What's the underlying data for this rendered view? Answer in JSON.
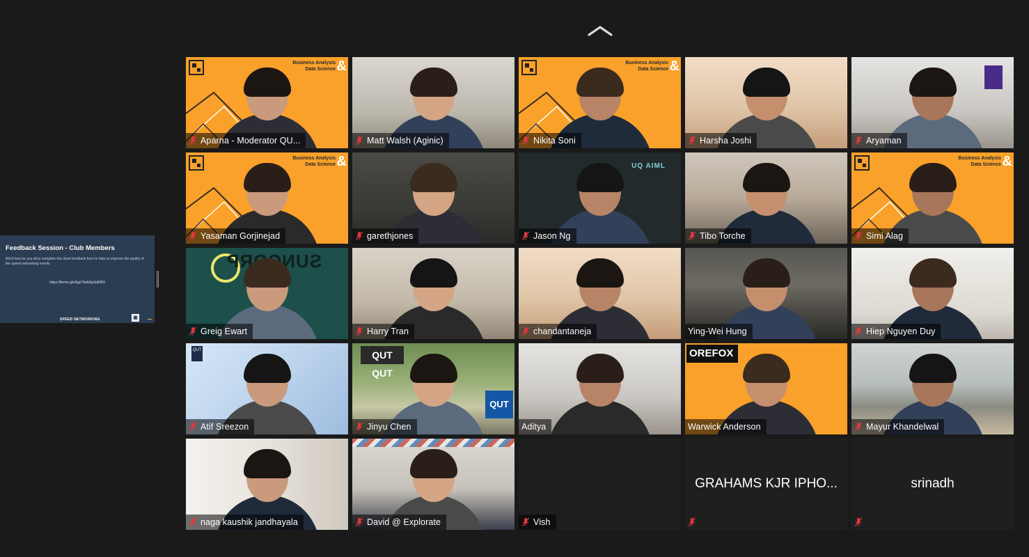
{
  "meeting": {
    "view": "gallery",
    "chevron_icon": "chevron-up-icon"
  },
  "share": {
    "title": "Feedback Session - Club Members",
    "body": "We'd love for you all to complete this short feedback form to help us improve the quality of the speed networking events",
    "link": "https://forms.gle/5gsT6ebGp3x8369",
    "brand": "SPEED NETWORKING"
  },
  "background_text": {
    "ba_ds": "Business Analysis\nData Science",
    "amp": "&",
    "suncorp": "SUNCORP",
    "uqaiml": "UQ AIML",
    "orefox": "OREFOX",
    "qut": "QUT",
    "qut_qut": "QUT QUT"
  },
  "participants": [
    {
      "name": "Aparna - Moderator QU...",
      "muted": true,
      "bg": "orange"
    },
    {
      "name": "Matt Walsh (Aginic)",
      "muted": true,
      "bg": "wall"
    },
    {
      "name": "Nikita Soni",
      "muted": true,
      "bg": "orange"
    },
    {
      "name": "Harsha Joshi",
      "muted": true,
      "bg": "warm"
    },
    {
      "name": "Aryaman",
      "muted": true,
      "bg": "room"
    },
    {
      "name": "Yasaman Gorjinejad",
      "muted": true,
      "bg": "orange"
    },
    {
      "name": "garethjones",
      "muted": true,
      "bg": "dim"
    },
    {
      "name": "Jason Ng",
      "muted": true,
      "bg": "uq"
    },
    {
      "name": "Tibo Torche",
      "muted": true,
      "bg": "hall"
    },
    {
      "name": "Simi Alag",
      "muted": true,
      "bg": "orange"
    },
    {
      "name": "Greig Ewart",
      "muted": true,
      "bg": "teal"
    },
    {
      "name": "Harry Tran",
      "muted": true,
      "bg": "beige"
    },
    {
      "name": "chandantaneja",
      "muted": true,
      "bg": "warm"
    },
    {
      "name": "Ying-Wei Hung",
      "muted": false,
      "bg": "corr"
    },
    {
      "name": "Hiep Nguyen Duy",
      "muted": true,
      "bg": "white"
    },
    {
      "name": "Atif Sreezon",
      "muted": true,
      "bg": "blue"
    },
    {
      "name": "Jinyu Chen",
      "muted": true,
      "bg": "park"
    },
    {
      "name": "Aditya",
      "muted": false,
      "bg": "room"
    },
    {
      "name": "Warwick Anderson",
      "muted": false,
      "bg": "orange"
    },
    {
      "name": "Mayur Khandelwal",
      "muted": true,
      "bg": "beach"
    },
    {
      "name": "naga kaushik jandhayala",
      "muted": true,
      "bg": "curtain"
    },
    {
      "name": "David @ Explorate",
      "muted": true,
      "bg": "bedroom"
    },
    {
      "name": "Vish",
      "muted": true,
      "bg": "none"
    },
    {
      "name": "GRAHAMS KJR IPHO...",
      "muted": true,
      "bg": "none",
      "video_off": true
    },
    {
      "name": "srinadh",
      "muted": true,
      "bg": "none",
      "video_off": true
    }
  ],
  "colors": {
    "background": "#1a1a1a",
    "tile_off": "#262626",
    "mute_red": "#e0383e",
    "brand_orange": "#f9a12a",
    "share_bg": "#2b3d52"
  }
}
